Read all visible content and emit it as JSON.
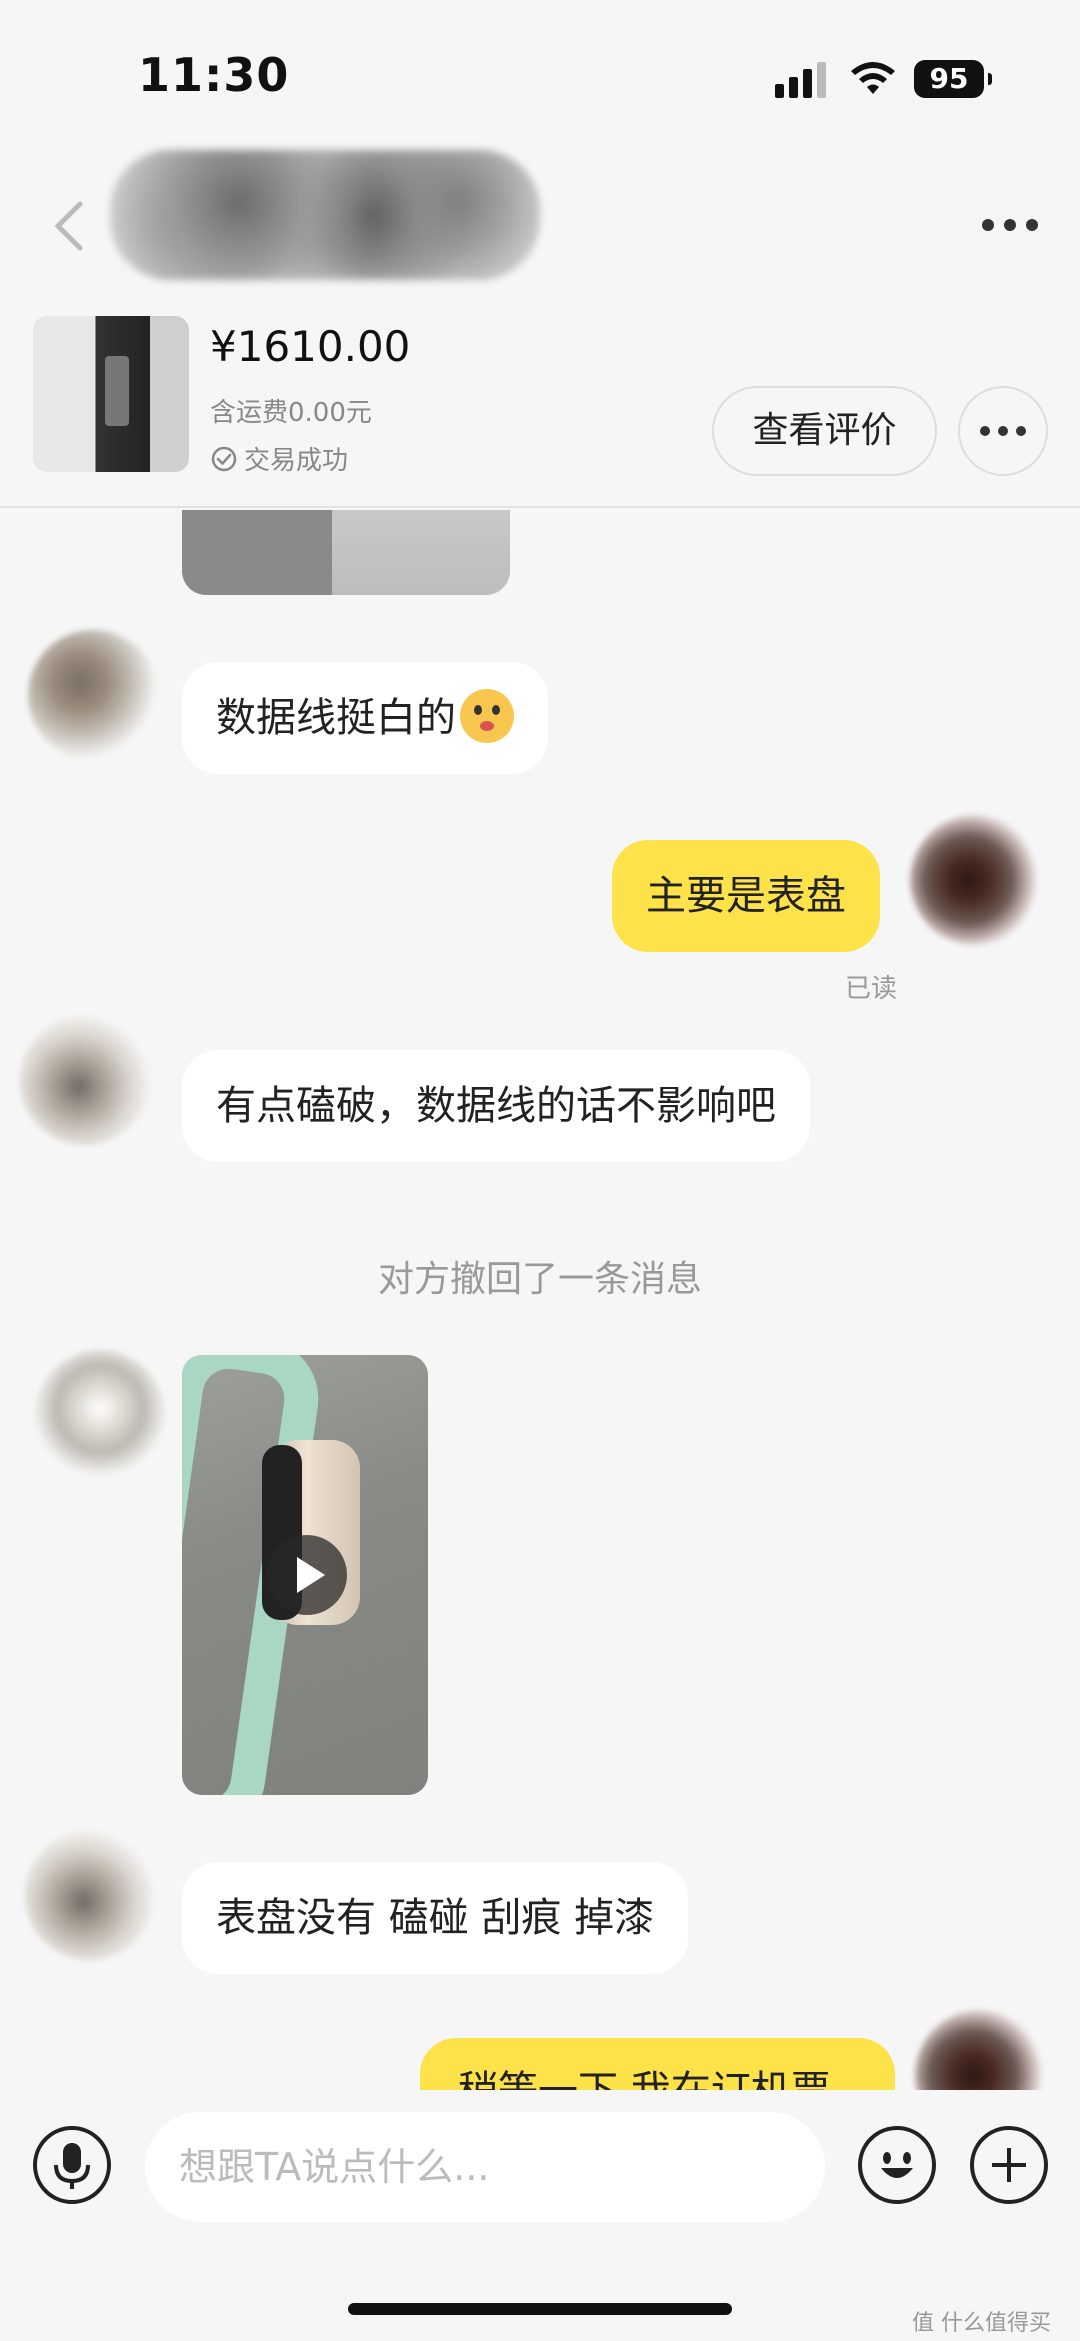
{
  "status_bar": {
    "time": "11:30",
    "battery": "95"
  },
  "header": {
    "back_icon": "chevron-left-icon",
    "menu_icon": "more-horizontal-icon"
  },
  "product": {
    "price": "¥1610.00",
    "shipping": "含运费0.00元",
    "status": "交易成功",
    "review_button": "查看评价"
  },
  "messages": [
    {
      "side": "left",
      "text": "数据线挺白的",
      "emoji": "shushing-face-emoji"
    },
    {
      "side": "right",
      "text": "主要是表盘",
      "read": "已读"
    },
    {
      "side": "left",
      "text": "有点磕破，数据线的话不影响吧"
    },
    {
      "system": "对方撤回了一条消息"
    },
    {
      "side": "left",
      "type": "video"
    },
    {
      "side": "left",
      "text": "表盘没有 磕碰 刮痕 掉漆"
    },
    {
      "side": "right",
      "text": "稍等一下 我在订机票"
    }
  ],
  "input": {
    "placeholder": "想跟TA说点什么..."
  },
  "watermark": "值 什么值得买",
  "colors": {
    "background": "#f6f6f6",
    "my_bubble": "#fde24a",
    "their_bubble": "#ffffff",
    "muted_text": "#999999"
  }
}
